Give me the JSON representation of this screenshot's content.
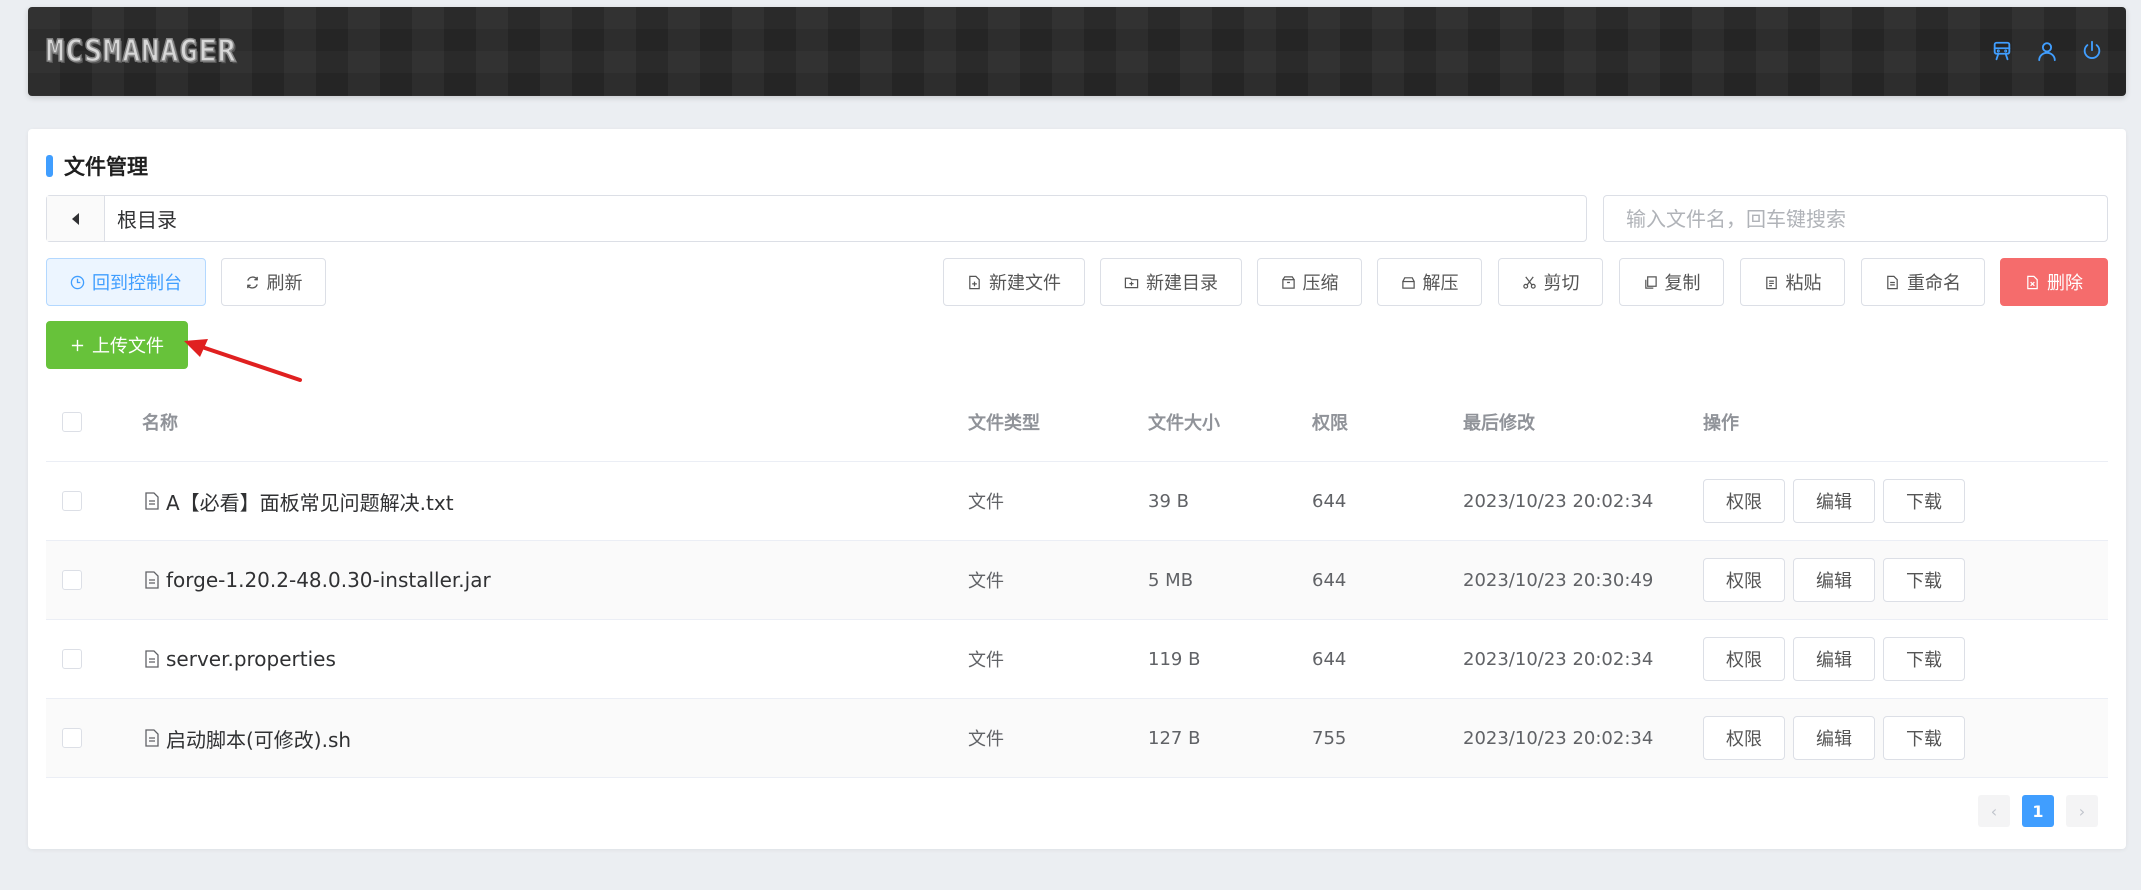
{
  "header": {
    "logo_text": "MCSMANAGER",
    "icons": [
      "server-icon",
      "user-icon",
      "power-icon"
    ],
    "icon_color": "#409eff"
  },
  "panel": {
    "title": "文件管理",
    "path": "根目录",
    "search_placeholder": "输入文件名，回车键搜索"
  },
  "toolbar": {
    "back_console": "回到控制台",
    "refresh": "刷新",
    "new_file": "新建文件",
    "new_dir": "新建目录",
    "compress": "压缩",
    "extract": "解压",
    "cut": "剪切",
    "copy": "复制",
    "paste": "粘贴",
    "rename": "重命名",
    "delete": "删除",
    "upload": "上传文件"
  },
  "table": {
    "columns": {
      "name": "名称",
      "type": "文件类型",
      "size": "文件大小",
      "perm": "权限",
      "modified": "最后修改",
      "ops": "操作"
    },
    "rows": [
      {
        "name": "A【必看】面板常见问题解决.txt",
        "type": "文件",
        "size": "39 B",
        "perm": "644",
        "modified": "2023/10/23 20:02:34"
      },
      {
        "name": "forge-1.20.2-48.0.30-installer.jar",
        "type": "文件",
        "size": "5 MB",
        "perm": "644",
        "modified": "2023/10/23 20:30:49"
      },
      {
        "name": "server.properties",
        "type": "文件",
        "size": "119 B",
        "perm": "644",
        "modified": "2023/10/23 20:02:34"
      },
      {
        "name": "启动脚本(可修改).sh",
        "type": "文件",
        "size": "127 B",
        "perm": "755",
        "modified": "2023/10/23 20:02:34"
      }
    ],
    "row_actions": {
      "perm": "权限",
      "edit": "编辑",
      "download": "下载"
    }
  },
  "pagination": {
    "current": "1",
    "prev": "‹",
    "next": "›"
  },
  "colors": {
    "primary": "#409eff",
    "success": "#67c23a",
    "danger": "#f56c6c",
    "annotation": "#e02020"
  }
}
